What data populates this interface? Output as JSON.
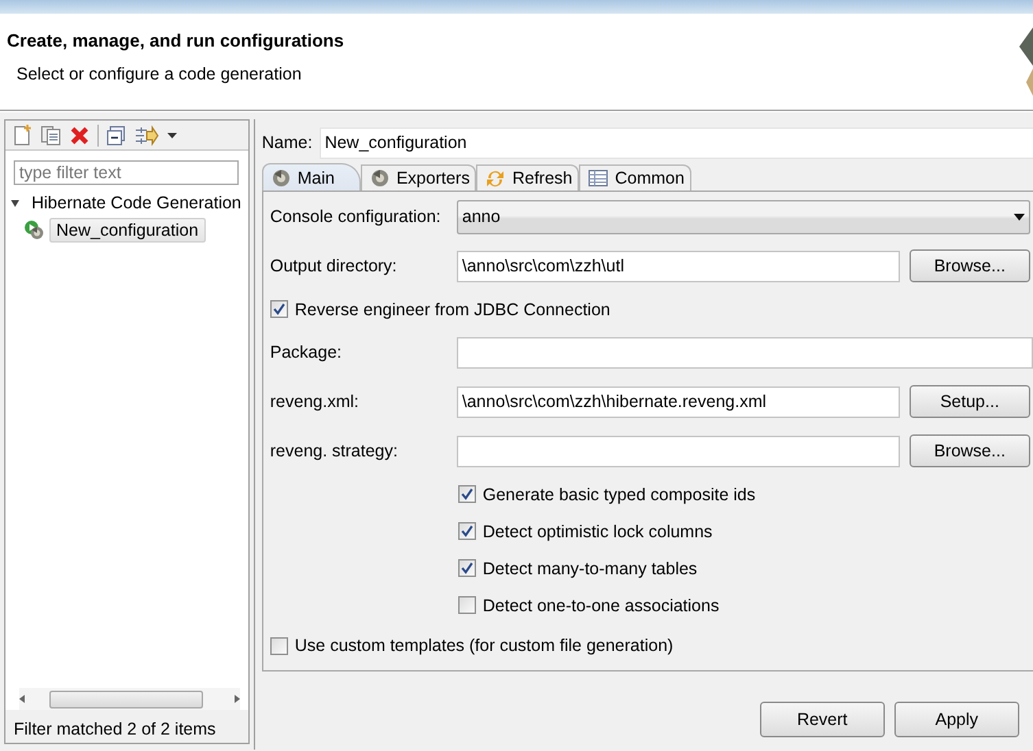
{
  "header": {
    "title": "Create, manage, and run configurations",
    "subtitle": "Select or configure a code generation"
  },
  "sidebar": {
    "filter": {
      "placeholder": "type filter text"
    },
    "tree": [
      {
        "label": "Hibernate Code Generation",
        "expanded": true,
        "children": [
          {
            "label": "New_configuration",
            "selected": true
          }
        ]
      }
    ],
    "status": "Filter matched 2 of 2 items"
  },
  "name": {
    "label": "Name:",
    "value": "New_configuration"
  },
  "tabs": [
    {
      "label": "Main",
      "selected": true
    },
    {
      "label": "Exporters",
      "selected": false
    },
    {
      "label": "Refresh",
      "selected": false
    },
    {
      "label": "Common",
      "selected": false
    }
  ],
  "form": [
    {
      "kind": "dropdown",
      "label": "Console configuration:",
      "value": "anno"
    },
    {
      "kind": "field",
      "label": "Output directory:",
      "value": "\\anno\\src\\com\\zzh\\utl",
      "button": "Browse..."
    },
    {
      "kind": "checkbox",
      "label": "Reverse engineer from JDBC Connection",
      "checked": true
    },
    {
      "kind": "field",
      "label": "Package:"
    },
    {
      "kind": "field",
      "label": "reveng.xml:",
      "value": "\\anno\\src\\com\\zzh\\hibernate.reveng.xml",
      "button": "Setup..."
    },
    {
      "kind": "field",
      "label": "reveng. strategy:",
      "button": "Browse..."
    },
    {
      "kind": "option",
      "label": "Generate basic typed composite ids",
      "checked": true
    },
    {
      "kind": "option",
      "label": "Detect optimistic lock columns",
      "checked": true
    },
    {
      "kind": "option",
      "label": "Detect many-to-many tables",
      "checked": true
    },
    {
      "kind": "option",
      "label": "Detect one-to-one associations",
      "checked": false
    },
    {
      "kind": "checkbox",
      "label": "Use custom templates (for custom file generation)",
      "checked": false
    }
  ],
  "buttons": [
    "Revert",
    "Apply"
  ]
}
